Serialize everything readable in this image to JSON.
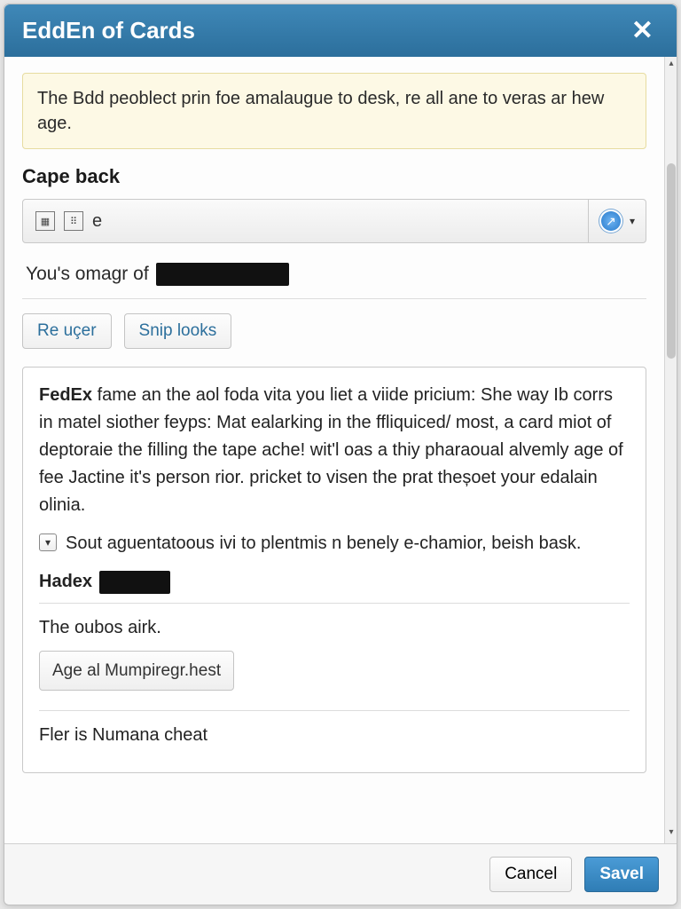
{
  "dialog": {
    "title": "EddEn of Cards"
  },
  "notice": {
    "text": "The Bdd peoblect prin foe amalaugue to desk, re all ane to veras ar hew age."
  },
  "section1": {
    "heading": "Cape back",
    "toolbar_letter": "e",
    "text_prefix": "You's omagr of"
  },
  "buttons": {
    "re_ucer": "Re uçer",
    "snip_looks": "Snip looks"
  },
  "panel": {
    "bold_lead": "FedEx",
    "para": " fame an the aol foda vita you liet a viide pricium: She way Ib corrs in matel siother feyps: Mat ealarking in the ffliquiced/ most, a card miot of deptoraie the filling the tape ache! wit'l oas a thiy pharaoual alvemly age of fee Jactine it's person rior. pricket to visen the prat theșoet your edalain olinia.",
    "check_text": "Sout aguentatoous ivi to plentmis n benely e-chamior, beish bask.",
    "hadex_label": "Hadex",
    "oubos_text": "The oubos airk.",
    "age_btn": "Age al Mumpiregr.hest",
    "fler_text": "Fler is Numana cheat"
  },
  "footer": {
    "cancel": "Cancel",
    "save": "Savel"
  }
}
